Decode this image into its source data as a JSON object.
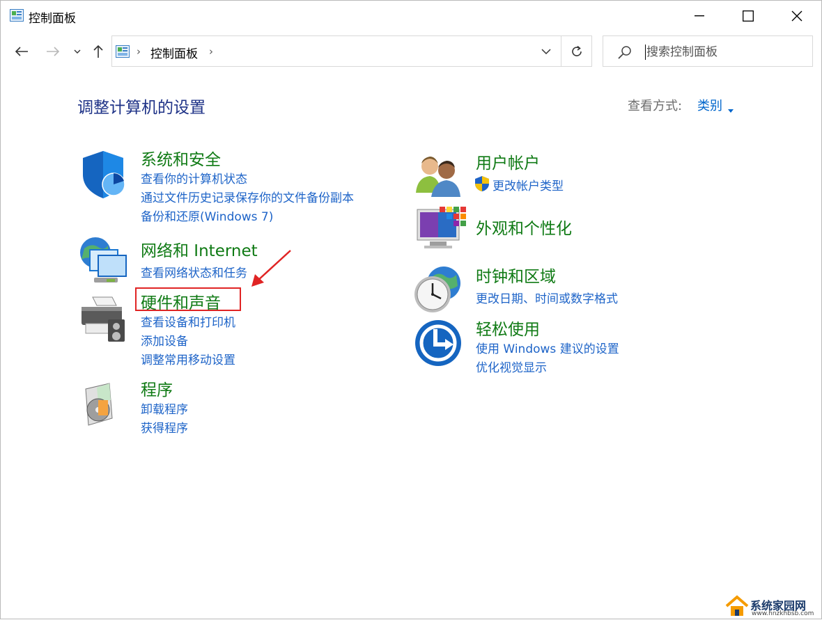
{
  "window": {
    "title": "控制面板"
  },
  "address": {
    "path": "控制面板",
    "separator": "›"
  },
  "search": {
    "placeholder": "搜索控制面板"
  },
  "header": {
    "title": "调整计算机的设置",
    "view_by_label": "查看方式:",
    "view_by_value": "类别"
  },
  "left_categories": [
    {
      "title": "系统和安全",
      "icon": "shield-icon",
      "links": [
        "查看你的计算机状态",
        "通过文件历史记录保存你的文件备份副本",
        "备份和还原(Windows 7)"
      ]
    },
    {
      "title": "网络和 Internet",
      "icon": "network-icon",
      "links": [
        "查看网络状态和任务"
      ]
    },
    {
      "title": "硬件和声音",
      "icon": "printer-icon",
      "links": [
        "查看设备和打印机",
        "添加设备",
        "调整常用移动设置"
      ]
    },
    {
      "title": "程序",
      "icon": "programs-icon",
      "links": [
        "卸载程序",
        "获得程序"
      ]
    }
  ],
  "right_categories": [
    {
      "title": "用户帐户",
      "icon": "users-icon",
      "links": [
        "更改帐户类型"
      ]
    },
    {
      "title": "外观和个性化",
      "icon": "appearance-icon",
      "links": []
    },
    {
      "title": "时钟和区域",
      "icon": "clock-globe-icon",
      "links": [
        "更改日期、时间或数字格式"
      ]
    },
    {
      "title": "轻松使用",
      "icon": "ease-of-access-icon",
      "links": [
        "使用 Windows 建议的设置",
        "优化视觉显示"
      ]
    }
  ],
  "watermark": {
    "text": "系统家园网",
    "subtext": "www.hnzkhbsb.com"
  },
  "colors": {
    "category_title": "#0f7a14",
    "link": "#1e64c8",
    "heading": "#1e3287",
    "highlight": "#e02424"
  }
}
